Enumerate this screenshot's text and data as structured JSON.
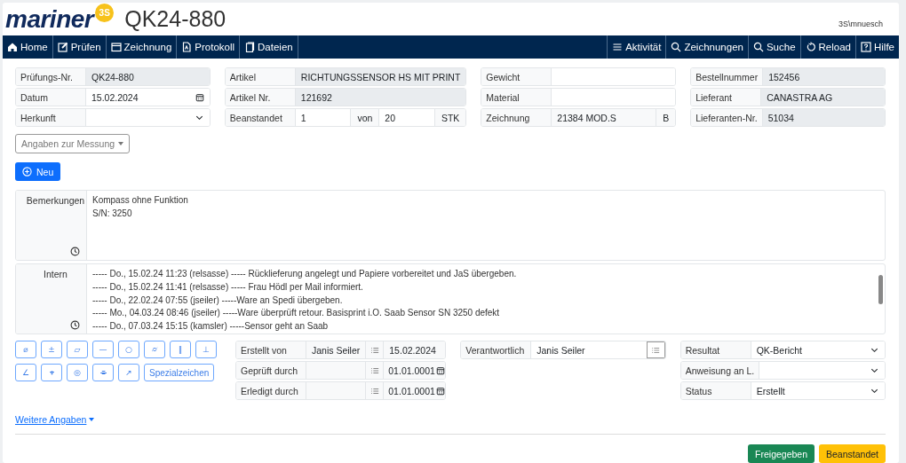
{
  "header": {
    "logo": {
      "text": "mariner",
      "badge": "3S"
    },
    "title": "QK24-880",
    "user": "3S\\mnuesch"
  },
  "nav": {
    "left": [
      "Home",
      "Prüfen",
      "Zeichnung",
      "Protokoll",
      "Dateien"
    ],
    "right": [
      "Aktivität",
      "Zeichnungen",
      "Suche",
      "Reload",
      "Hilfe"
    ]
  },
  "top_columns": [
    [
      {
        "segments": [
          {
            "kind": "label",
            "text": "Prüfungs-Nr."
          },
          {
            "kind": "readonly",
            "text": "QK24-880"
          }
        ]
      },
      {
        "segments": [
          {
            "kind": "label",
            "text": "Datum"
          },
          {
            "kind": "date",
            "text": "15.02.2024"
          }
        ]
      },
      {
        "segments": [
          {
            "kind": "label",
            "text": "Herkunft"
          },
          {
            "kind": "select"
          }
        ]
      }
    ],
    [
      {
        "segments": [
          {
            "kind": "label",
            "text": "Artikel"
          },
          {
            "kind": "readonly",
            "text": "RICHTUNGSSENSOR HS MIT PRINT"
          }
        ]
      },
      {
        "segments": [
          {
            "kind": "label",
            "text": "Artikel Nr."
          },
          {
            "kind": "readonly",
            "text": "121692"
          }
        ]
      },
      {
        "segments": [
          {
            "kind": "label",
            "text": "Beanstandet"
          },
          {
            "kind": "input",
            "text": "1"
          },
          {
            "kind": "unit",
            "text": "von"
          },
          {
            "kind": "input",
            "text": "20"
          },
          {
            "kind": "unit",
            "text": "STK"
          }
        ]
      }
    ],
    [
      {
        "segments": [
          {
            "kind": "label",
            "text": "Gewicht"
          },
          {
            "kind": "input"
          }
        ]
      },
      {
        "segments": [
          {
            "kind": "label",
            "text": "Material"
          },
          {
            "kind": "input"
          }
        ]
      },
      {
        "segments": [
          {
            "kind": "label",
            "text": "Zeichnung"
          },
          {
            "kind": "addon",
            "text": "21384 MOD.S"
          },
          {
            "kind": "unit",
            "text": "B"
          }
        ]
      }
    ],
    [
      {
        "segments": [
          {
            "kind": "label",
            "text": "Bestellnummer"
          },
          {
            "kind": "readonly",
            "text": "152456"
          }
        ]
      },
      {
        "segments": [
          {
            "kind": "label",
            "text": "Lieferant"
          },
          {
            "kind": "readonly",
            "text": "CANASTRA AG"
          }
        ]
      },
      {
        "segments": [
          {
            "kind": "label",
            "text": "Lieferanten-Nr."
          },
          {
            "kind": "readonly",
            "text": "51034"
          }
        ]
      }
    ]
  ],
  "measurement_dropdown": "Angaben zur Messung",
  "new_button": "Neu",
  "remarks": {
    "label": "Bemerkungen",
    "lines": [
      "Kompass ohne Funktion",
      "S/N: 3250"
    ]
  },
  "internal": {
    "label": "Intern",
    "lines": [
      "----- Do., 15.02.24 11:23 (relsasse) ----- Rücklieferung angelegt und Papiere vorbereitet und JaS übergeben.",
      "----- Do., 15.02.24 11:41 (relsasse) ----- Frau Hödl per Mail informiert.",
      "----- Do., 22.02.24 07:55 (jseiler) -----Ware an Spedi übergeben.",
      "----- Mo., 04.03.24 08:46 (jseiler) -----Ware überprüft retour. Basisprint i.O. Saab Sensor SN 3250 defekt",
      "----- Do., 07.03.24 15:15 (kamsler) -----Sensor geht an Saab"
    ]
  },
  "special_chars": {
    "symbols": [
      "⌀",
      "±",
      "▱",
      "—",
      "○",
      "⌭",
      "∥",
      "⊥",
      "∠",
      "⌖",
      "◎",
      "⌯",
      "↗"
    ],
    "button": "Spezialzeichen"
  },
  "bottom_columns": [
    [
      {
        "segments": [
          {
            "kind": "label",
            "text": "Erstellt von"
          },
          {
            "kind": "addon",
            "text": "Janis Seiler"
          },
          {
            "kind": "list"
          },
          {
            "kind": "addon-fixed",
            "text": "15.02.2024"
          }
        ]
      },
      {
        "segments": [
          {
            "kind": "label",
            "text": "Geprüft durch"
          },
          {
            "kind": "addon"
          },
          {
            "kind": "list"
          },
          {
            "kind": "addon-date",
            "text": "01.01.0001"
          }
        ]
      },
      {
        "segments": [
          {
            "kind": "label",
            "text": "Erledigt durch"
          },
          {
            "kind": "addon"
          },
          {
            "kind": "list"
          },
          {
            "kind": "addon-date",
            "text": "01.01.0001"
          }
        ]
      }
    ],
    [
      {
        "segments": [
          {
            "kind": "label",
            "text": "Verantwortlich"
          },
          {
            "kind": "input",
            "text": "Janis Seiler"
          },
          {
            "kind": "list-button"
          }
        ]
      }
    ],
    [
      {
        "segments": [
          {
            "kind": "label",
            "text": "Resultat"
          },
          {
            "kind": "select",
            "text": "QK-Bericht"
          }
        ]
      },
      {
        "segments": [
          {
            "kind": "label",
            "text": "Anweisung an L."
          },
          {
            "kind": "select"
          }
        ]
      },
      {
        "segments": [
          {
            "kind": "label",
            "text": "Status"
          },
          {
            "kind": "select",
            "text": "Erstellt"
          }
        ]
      }
    ]
  ],
  "more_link": "Weitere Angaben",
  "actions": [
    {
      "label": "Freigegeben",
      "kind": "success"
    },
    {
      "label": "Beanstandet",
      "kind": "warning"
    }
  ]
}
